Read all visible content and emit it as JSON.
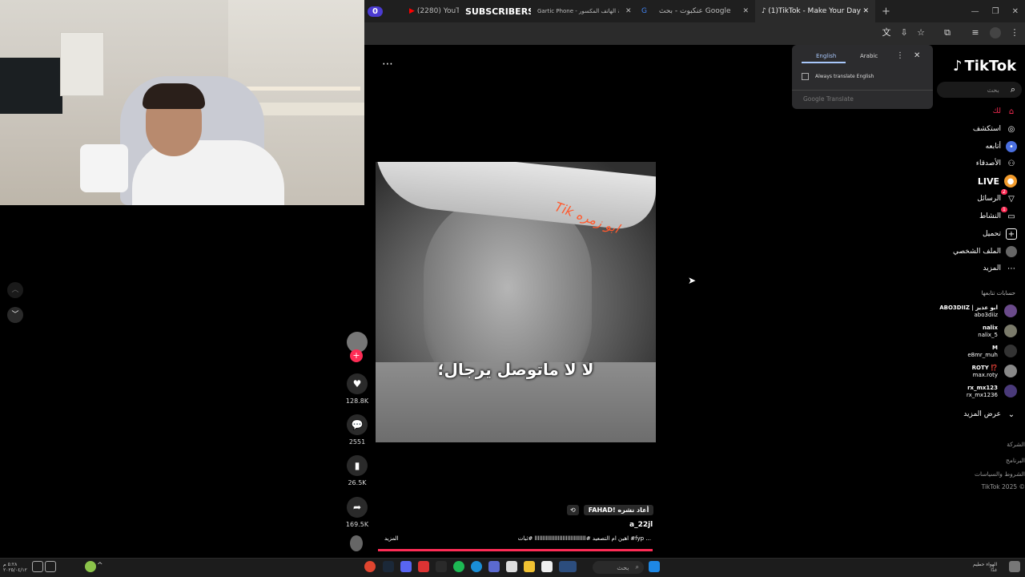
{
  "browser": {
    "tabs": [
      {
        "label": "(2280) YouTube"
      },
      {
        "label": "SUBSCRIBERS"
      },
      {
        "label": "Gartic Phone - نسخة الهاتف المكسور"
      },
      {
        "label": "عنكبوت - بحث Google"
      },
      {
        "label": "(1)TikTok - Make Your Day"
      }
    ],
    "subscriber_left_count": "0",
    "subscriber_right_count": "25",
    "new_tab_label": "+"
  },
  "translate_popup": {
    "tab_english": "English",
    "tab_arabic": "Arabic",
    "always_translate_label": "Always translate English",
    "google_translate_label": "Google Translate"
  },
  "video": {
    "subtitle": "لا لا ماتوصل يرجال؛",
    "watermark_text": "Tik ابو زمره",
    "more_icon": "⋯"
  },
  "post": {
    "repost_label": "FAHAD! أعاد نشره",
    "username": "a_22jl",
    "caption": "اهين ام التصعيد #ااااااااااااااااااااااااااااااااا #ثبات #fyp ...",
    "more_label": "المزيد"
  },
  "actions": {
    "likes": "128.8K",
    "comments": "2551",
    "saves": "26.5K",
    "shares": "169.5K"
  },
  "tiktok": {
    "logo_text": "TikTok",
    "search_placeholder": "بحث",
    "nav": [
      {
        "label": "لك",
        "icon": "home-icon"
      },
      {
        "label": "استكشف",
        "icon": "compass-icon"
      },
      {
        "label": "أتابعه",
        "icon": "following-icon"
      },
      {
        "label": "الأصدقاء",
        "icon": "friends-icon"
      },
      {
        "label": "LIVE",
        "icon": "live-icon"
      },
      {
        "label": "الرسائل",
        "icon": "messages-icon"
      },
      {
        "label": "النشاط",
        "icon": "activity-icon"
      },
      {
        "label": "تحميل",
        "icon": "upload-icon"
      },
      {
        "label": "الملف الشخصي",
        "icon": "profile-icon"
      },
      {
        "label": "المزيد",
        "icon": "more-icon"
      }
    ],
    "messages_badge": "2",
    "activity_badge": "1",
    "following_header": "حسابات تتابعها",
    "following": [
      {
        "name": "ABO3DIIZ | ابو عذيز",
        "handle": "abo3diiz"
      },
      {
        "name": "nalix",
        "handle": "nalix_5"
      },
      {
        "name": "M",
        "handle": "e8mr_muh"
      },
      {
        "name": "ROTY ⁉️",
        "handle": "max.roty"
      },
      {
        "name": "rx_mx123",
        "handle": "rx_mx1236"
      }
    ],
    "see_more_label": "عرض المزيد",
    "footer": [
      "الشركة",
      "البرنامج",
      "الشروط والسياسات",
      "TikTok 2025 ©"
    ]
  },
  "taskbar": {
    "search_label": "بحث",
    "clock_line1": "٥:٢٨ م",
    "clock_line2": "٢٠٢٥/٠٤/١٢",
    "weather_line1": "الهواء حطيم",
    "weather_line2": "غدًا"
  }
}
